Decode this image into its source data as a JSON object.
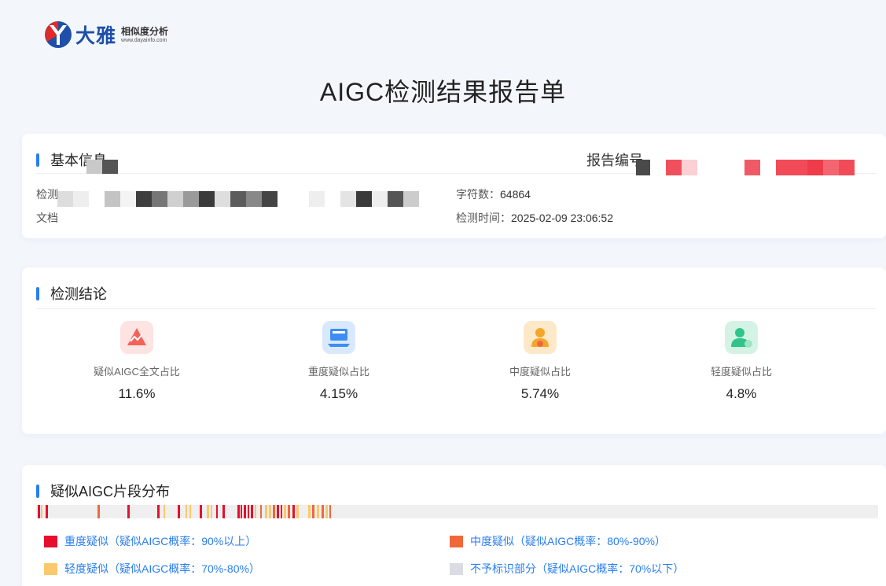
{
  "logo": {
    "brand": "大雅",
    "subtitle": "相似度分析",
    "url": "www.dayainfo.com"
  },
  "title": "AIGC检测结果报告单",
  "basic": {
    "heading": "基本信息",
    "report_no_label": "报告编号",
    "detect_label": "检测",
    "doc_label": "文档",
    "char_count_label": "字符数：",
    "char_count": "64864",
    "detect_time_label": "检测时间：",
    "detect_time": "2025-02-09 23:06:52"
  },
  "conclusion": {
    "heading": "检测结论",
    "stats": [
      {
        "label": "疑似AIGC全文占比",
        "value": "11.6%",
        "icon": "triangle-chart-icon",
        "color": "#f3625a"
      },
      {
        "label": "重度疑似占比",
        "value": "4.15%",
        "icon": "laptop-icon",
        "color": "#3d8df5"
      },
      {
        "label": "中度疑似占比",
        "value": "5.74%",
        "icon": "person-warning-icon",
        "color": "#f4a62a"
      },
      {
        "label": "轻度疑似占比",
        "value": "4.8%",
        "icon": "person-check-icon",
        "color": "#2fc48a"
      }
    ]
  },
  "distribution": {
    "heading": "疑似AIGC片段分布",
    "colors": {
      "heavy": "#e60f2d",
      "medium": "#f0683a",
      "light": "#fbc86b",
      "none": "#d9dde3"
    },
    "legend": [
      {
        "key": "heavy",
        "label": "重度疑似（疑似AIGC概率：90%以上）"
      },
      {
        "key": "medium",
        "label": "中度疑似（疑似AIGC概率：80%-90%）"
      },
      {
        "key": "light",
        "label": "轻度疑似（疑似AIGC概率：70%-80%）"
      },
      {
        "key": "none",
        "label": "不予标识部分（疑似AIGC概率：70%以下）"
      }
    ]
  }
}
